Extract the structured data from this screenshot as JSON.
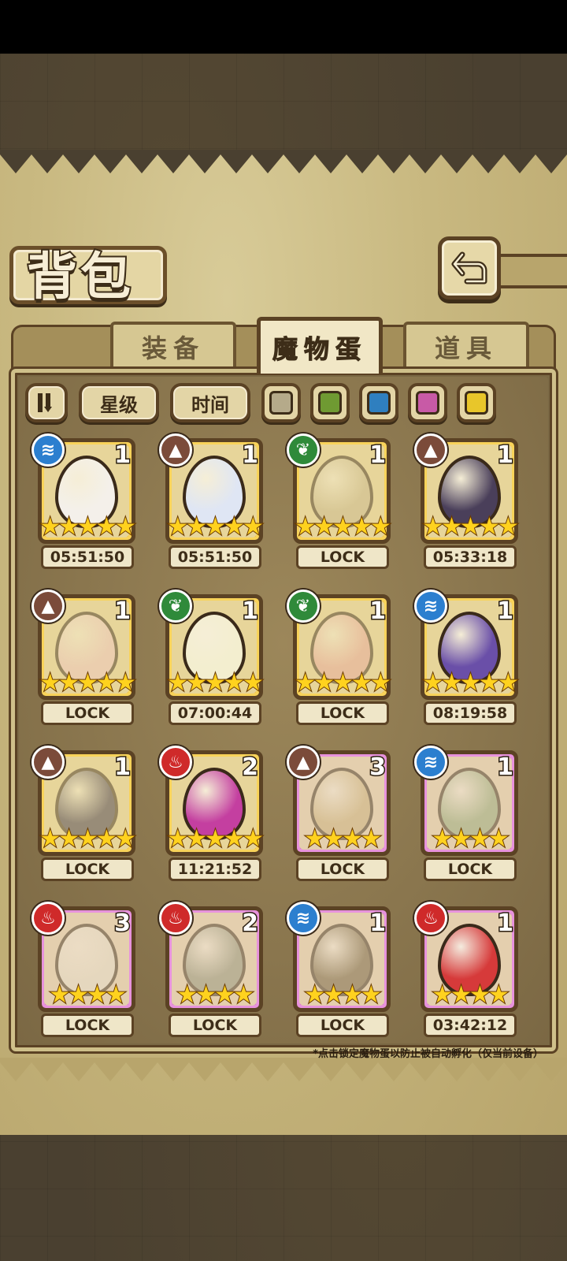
{
  "title": "背包",
  "tabs": [
    {
      "label": "装备"
    },
    {
      "label": "魔物蛋"
    },
    {
      "label": "道具"
    }
  ],
  "filters": {
    "star_label": "星级",
    "time_label": "时间",
    "colors": [
      "#b5aa8a",
      "#6f9a32",
      "#2f7fbf",
      "#c85aa6",
      "#e8c62a"
    ]
  },
  "eggs": [
    {
      "element": "water",
      "count": "1",
      "stars": 5,
      "status": "05:51:50",
      "rarity": "gold",
      "color": "#f4f0ea"
    },
    {
      "element": "earth",
      "count": "1",
      "stars": 5,
      "status": "05:51:50",
      "rarity": "gold",
      "color": "#dfe6f4"
    },
    {
      "element": "nature",
      "count": "1",
      "stars": 5,
      "status": "LOCK",
      "rarity": "gold",
      "color": "#c7b890"
    },
    {
      "element": "earth",
      "count": "1",
      "stars": 5,
      "status": "05:33:18",
      "rarity": "gold",
      "color": "#4a3f5a"
    },
    {
      "element": "earth",
      "count": "1",
      "stars": 5,
      "status": "LOCK",
      "rarity": "gold",
      "color": "#f0c7c7"
    },
    {
      "element": "nature",
      "count": "1",
      "stars": 5,
      "status": "07:00:44",
      "rarity": "gold",
      "color": "#f3eecf"
    },
    {
      "element": "nature",
      "count": "1",
      "stars": 5,
      "status": "LOCK",
      "rarity": "gold",
      "color": "#e9a6a0"
    },
    {
      "element": "water",
      "count": "1",
      "stars": 5,
      "status": "08:19:58",
      "rarity": "gold",
      "color": "#6a4fa8"
    },
    {
      "element": "earth",
      "count": "1",
      "stars": 5,
      "status": "LOCK",
      "rarity": "gold",
      "color": "#3a3550"
    },
    {
      "element": "fire",
      "count": "2",
      "stars": 5,
      "status": "11:21:52",
      "rarity": "gold",
      "color": "#c43fa0"
    },
    {
      "element": "earth",
      "count": "3",
      "stars": 4,
      "status": "LOCK",
      "rarity": "purple",
      "color": "#c9b07a"
    },
    {
      "element": "water",
      "count": "1",
      "stars": 4,
      "status": "LOCK",
      "rarity": "purple",
      "color": "#8fa87a"
    },
    {
      "element": "fire",
      "count": "3",
      "stars": 4,
      "status": "LOCK",
      "rarity": "purple",
      "color": "#e8e2d2"
    },
    {
      "element": "fire",
      "count": "2",
      "stars": 4,
      "status": "LOCK",
      "rarity": "purple",
      "color": "#8a8f7a"
    },
    {
      "element": "water",
      "count": "1",
      "stars": 4,
      "status": "LOCK",
      "rarity": "purple",
      "color": "#6a5a3a"
    },
    {
      "element": "fire",
      "count": "1",
      "stars": 4,
      "status": "03:42:12",
      "rarity": "purple",
      "color": "#d63a3a"
    }
  ],
  "note": "*点击锁定魔物蛋以防止被自动孵化（仅当前设备）"
}
